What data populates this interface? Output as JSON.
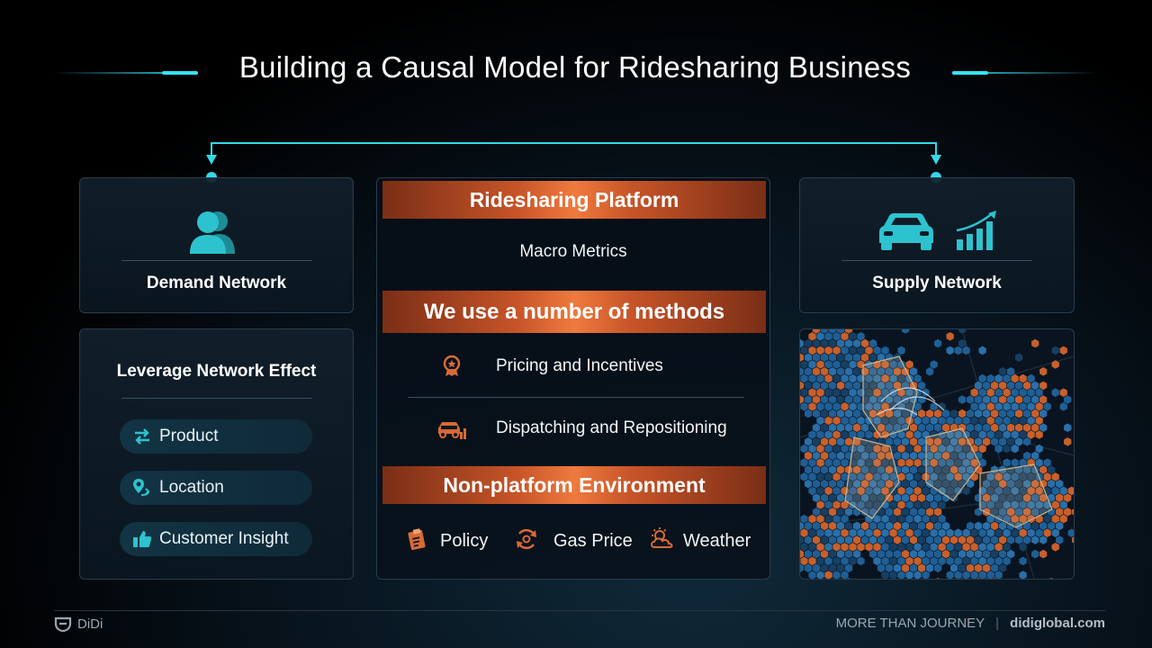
{
  "title": "Building a Causal Model for Ridesharing Business",
  "demand": {
    "label": "Demand Network",
    "icon": "users-icon"
  },
  "supply": {
    "label": "Supply Network",
    "icons": [
      "car-icon",
      "bar-chart-growth-icon"
    ]
  },
  "network_effect": {
    "heading": "Leverage Network Effect",
    "items": [
      {
        "label": "Product",
        "icon": "swap-arrows-icon"
      },
      {
        "label": "Location",
        "icon": "location-pin-icon"
      },
      {
        "label": "Customer Insight",
        "icon": "thumbs-up-icon"
      }
    ]
  },
  "center": {
    "platform_header": "Ridesharing Platform",
    "macro_metrics": "Macro Metrics",
    "methods_header": "We use a number of methods",
    "methods": [
      {
        "label": "Pricing and Incentives",
        "icon": "award-badge-icon"
      },
      {
        "label": "Dispatching and Repositioning",
        "icon": "car-chart-icon"
      }
    ],
    "environment_header": "Non-platform Environment",
    "environment": [
      {
        "label": "Policy",
        "icon": "clipboard-icon"
      },
      {
        "label": "Gas Price",
        "icon": "cycle-arrows-icon"
      },
      {
        "label": "Weather",
        "icon": "sun-cloud-icon"
      }
    ]
  },
  "map": {
    "icon": "hex-heatmap-image"
  },
  "footer": {
    "brand": "DiDi",
    "tagline": "MORE THAN JOURNEY",
    "separator": "|",
    "website": "didiglobal.com"
  },
  "colors": {
    "accent_teal": "#2fd6e6",
    "accent_orange": "#ef7a3e",
    "map_blue": "#1f5f95"
  }
}
